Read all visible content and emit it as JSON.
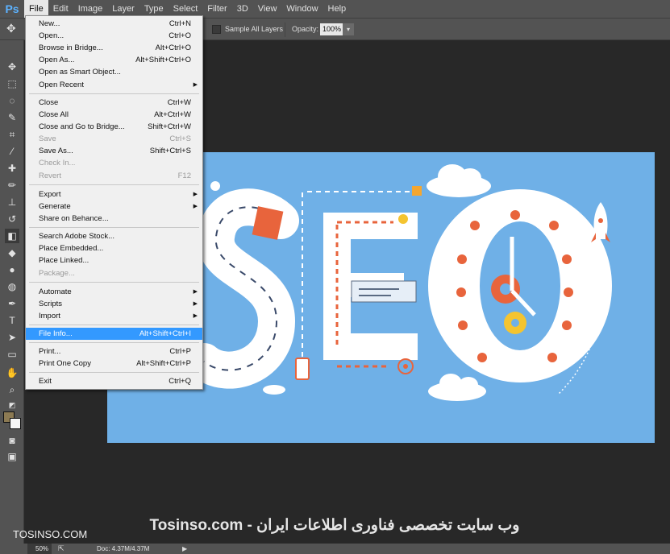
{
  "app": {
    "logo": "Ps"
  },
  "menubar": [
    "File",
    "Edit",
    "Image",
    "Layer",
    "Type",
    "Select",
    "Filter",
    "3D",
    "View",
    "Window",
    "Help"
  ],
  "options": {
    "sample_all_layers": "Sample All Layers",
    "opacity_label": "Opacity:",
    "opacity_value": "100%"
  },
  "file_menu": {
    "items": [
      {
        "label": "New...",
        "shortcut": "Ctrl+N"
      },
      {
        "label": "Open...",
        "shortcut": "Ctrl+O"
      },
      {
        "label": "Browse in Bridge...",
        "shortcut": "Alt+Ctrl+O"
      },
      {
        "label": "Open As...",
        "shortcut": "Alt+Shift+Ctrl+O"
      },
      {
        "label": "Open as Smart Object...",
        "shortcut": ""
      },
      {
        "label": "Open Recent",
        "shortcut": "",
        "submenu": true
      },
      {
        "label": "Close",
        "shortcut": "Ctrl+W"
      },
      {
        "label": "Close All",
        "shortcut": "Alt+Ctrl+W"
      },
      {
        "label": "Close and Go to Bridge...",
        "shortcut": "Shift+Ctrl+W"
      },
      {
        "label": "Save",
        "shortcut": "Ctrl+S",
        "disabled": true
      },
      {
        "label": "Save As...",
        "shortcut": "Shift+Ctrl+S"
      },
      {
        "label": "Check In...",
        "shortcut": "",
        "disabled": true
      },
      {
        "label": "Revert",
        "shortcut": "F12",
        "disabled": true
      },
      {
        "label": "Export",
        "shortcut": "",
        "submenu": true
      },
      {
        "label": "Generate",
        "shortcut": "",
        "submenu": true
      },
      {
        "label": "Share on Behance...",
        "shortcut": ""
      },
      {
        "label": "Search Adobe Stock...",
        "shortcut": ""
      },
      {
        "label": "Place Embedded...",
        "shortcut": ""
      },
      {
        "label": "Place Linked...",
        "shortcut": ""
      },
      {
        "label": "Package...",
        "shortcut": "",
        "disabled": true
      },
      {
        "label": "Automate",
        "shortcut": "",
        "submenu": true
      },
      {
        "label": "Scripts",
        "shortcut": "",
        "submenu": true
      },
      {
        "label": "Import",
        "shortcut": "",
        "submenu": true
      },
      {
        "label": "File Info...",
        "shortcut": "Alt+Shift+Ctrl+I",
        "highlighted": true
      },
      {
        "label": "Print...",
        "shortcut": "Ctrl+P"
      },
      {
        "label": "Print One Copy",
        "shortcut": "Alt+Shift+Ctrl+P"
      },
      {
        "label": "Exit",
        "shortcut": "Ctrl+Q"
      }
    ]
  },
  "canvas": {
    "text": "SEO",
    "background": "#6fb0e7",
    "accent": "#e8643c"
  },
  "watermark": {
    "left": "TOSINSO.COM",
    "center": "Tosinso.com - وب سایت تخصصی فناوری اطلاعات ایران"
  },
  "statusbar": {
    "zoom": "50%",
    "doc": "Doc: 4.37M/4.37M"
  },
  "colors": {
    "ui_panel": "#535353",
    "workspace": "#282828",
    "menu_highlight": "#3399ff",
    "foreground_swatch": "#8c7a53",
    "background_swatch": "#f5f5f5"
  }
}
